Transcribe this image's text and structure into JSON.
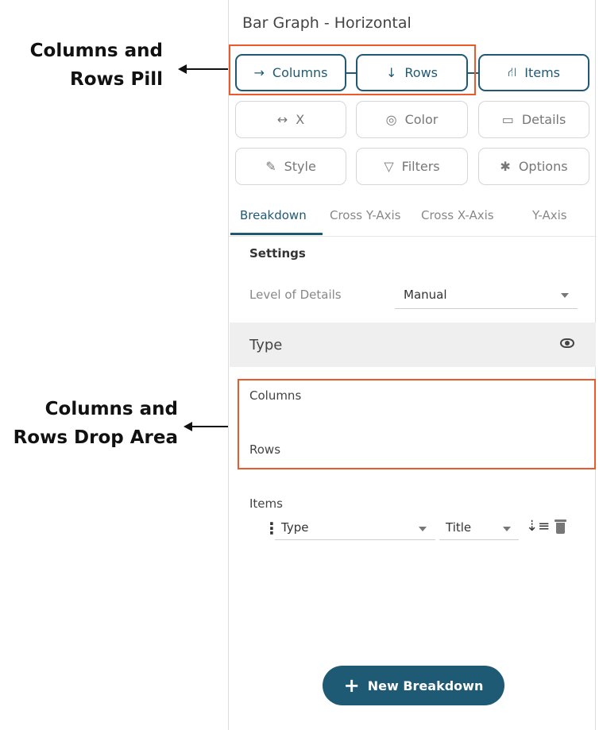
{
  "annotations": {
    "pill_line1": "Columns and",
    "pill_line2": "Rows Pill",
    "drop_line1": "Columns and",
    "drop_line2": "Rows Drop Area"
  },
  "panel": {
    "title": "Bar Graph - Horizontal"
  },
  "pills": {
    "columns": {
      "label": "Columns",
      "icon": "arrow-right-icon",
      "glyph": "→"
    },
    "rows": {
      "label": "Rows",
      "icon": "arrow-down-icon",
      "glyph": "↓"
    },
    "items": {
      "label": "Items",
      "icon": "hierarchy-icon",
      "glyph": "⛙"
    },
    "x": {
      "label": "X",
      "icon": "horizontal-arrows-icon",
      "glyph": "↔"
    },
    "color": {
      "label": "Color",
      "icon": "palette-icon",
      "glyph": "◎"
    },
    "details": {
      "label": "Details",
      "icon": "comment-icon",
      "glyph": "▭"
    },
    "style": {
      "label": "Style",
      "icon": "brush-icon",
      "glyph": "✎"
    },
    "filters": {
      "label": "Filters",
      "icon": "filter-icon",
      "glyph": "▽"
    },
    "options": {
      "label": "Options",
      "icon": "gear-icon",
      "glyph": "✱"
    }
  },
  "tabs": [
    "Breakdown",
    "Cross Y-Axis",
    "Cross X-Axis",
    "Y-Axis"
  ],
  "settings": {
    "heading": "Settings",
    "level_of_details_label": "Level of Details",
    "level_of_details_value": "Manual"
  },
  "type_section": {
    "label": "Type"
  },
  "drop_area": {
    "columns_label": "Columns",
    "rows_label": "Rows"
  },
  "items_section": {
    "heading": "Items",
    "field_value": "Type",
    "title_value": "Title"
  },
  "new_breakdown": {
    "label": "New Breakdown"
  },
  "colors": {
    "accent": "#1f5a74",
    "highlight": "#ec5a2c"
  }
}
